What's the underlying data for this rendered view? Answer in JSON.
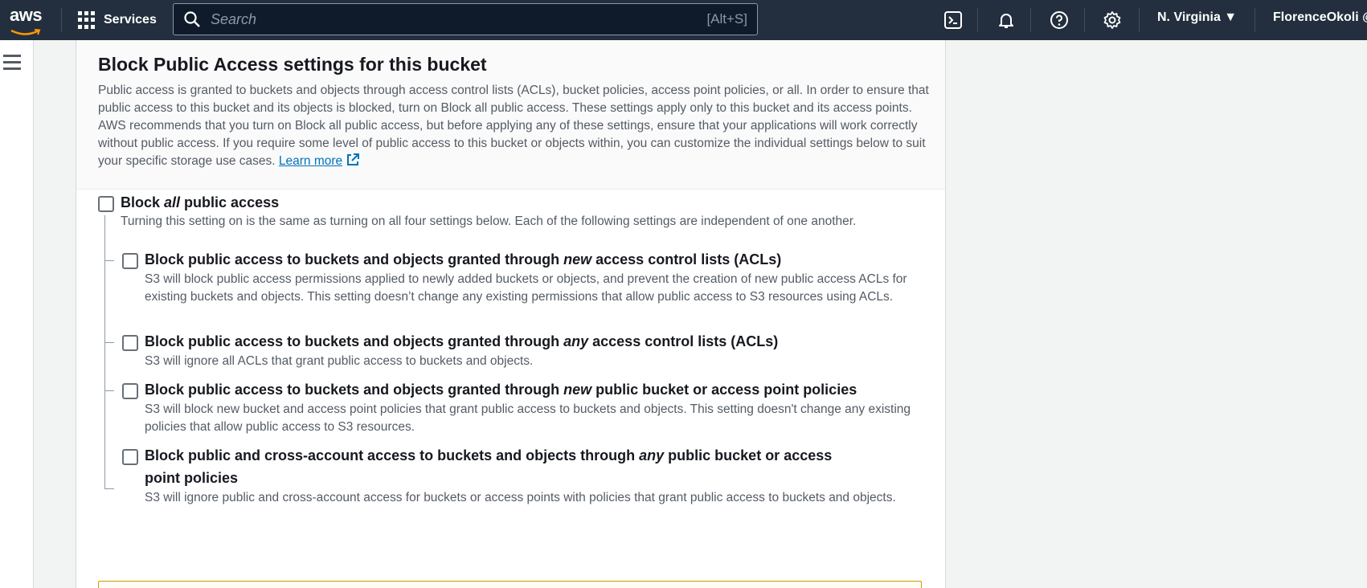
{
  "topnav": {
    "logo_text": "aws",
    "services_label": "Services",
    "search": {
      "placeholder": "Search",
      "value": "",
      "shortcut": "[Alt+S]"
    },
    "region": "N. Virginia ▼",
    "user": "FlorenceOkoli @"
  },
  "icons": {
    "cloudshell": "cloudshell-icon",
    "notifications": "bell-icon",
    "help": "help-icon",
    "settings": "gear-icon",
    "menu": "hamburger-icon"
  },
  "colors": {
    "nav_bg": "#232f3e",
    "link": "#0073bb",
    "warning_border": "#d09a00"
  },
  "panel": {
    "title": "Block Public Access settings for this bucket",
    "description": "Public access is granted to buckets and objects through access control lists (ACLs), bucket policies, access point policies, or all. In order to ensure that public access to this bucket and its objects is blocked, turn on Block all public access. These settings apply only to this bucket and its access points. AWS recommends that you turn on Block all public access, but before applying any of these settings, ensure that your applications will work correctly without public access. If you require some level of public access to this bucket or objects within, you can customize the individual settings below to suit your specific storage use cases.",
    "learn_more": "Learn more"
  },
  "block_all": {
    "title_pre": "Block ",
    "title_em": "all",
    "title_post": " public access",
    "description": "Turning this setting on is the same as turning on all four settings below. Each of the following settings are independent of one another.",
    "checked": false
  },
  "options": [
    {
      "title_pre": "Block public access to buckets and objects granted through ",
      "title_em": "new",
      "title_post": " access control lists (ACLs)",
      "description": "S3 will block public access permissions applied to newly added buckets or objects, and prevent the creation of new public access ACLs for existing buckets and objects. This setting doesn’t change any existing permissions that allow public access to S3 resources using ACLs.",
      "checked": false
    },
    {
      "title_pre": "Block public access to buckets and objects granted through ",
      "title_em": "any",
      "title_post": " access control lists (ACLs)",
      "description": "S3 will ignore all ACLs that grant public access to buckets and objects.",
      "checked": false
    },
    {
      "title_pre": "Block public access to buckets and objects granted through ",
      "title_em": "new",
      "title_post": " public bucket or access point policies",
      "description": "S3 will block new bucket and access point policies that grant public access to buckets and objects. This setting doesn't change any existing policies that allow public access to S3 resources.",
      "checked": false
    },
    {
      "title_pre": "Block public and cross-account access to buckets and objects through ",
      "title_em": "any",
      "title_post": " public bucket or access point policies",
      "description": "S3 will ignore public and cross-account access for buckets or access points with policies that grant public access to buckets and objects.",
      "checked": false
    }
  ]
}
